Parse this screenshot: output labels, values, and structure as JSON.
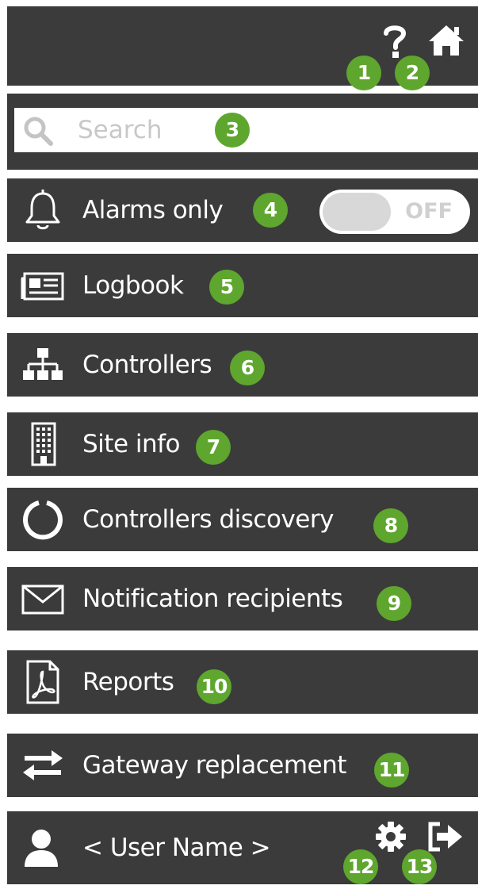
{
  "top_bar": {
    "help_icon": "question-mark-icon",
    "home_icon": "home-icon"
  },
  "search": {
    "placeholder": "Search"
  },
  "alarms": {
    "label": "Alarms only",
    "toggle_state": "OFF"
  },
  "menu": [
    {
      "label": "Logbook",
      "icon": "newspaper-icon"
    },
    {
      "label": "Controllers",
      "icon": "network-hierarchy-icon"
    },
    {
      "label": "Site info",
      "icon": "building-icon"
    },
    {
      "label": "Controllers discovery",
      "icon": "loading-ring-icon"
    },
    {
      "label": "Notification recipients",
      "icon": "envelope-icon"
    },
    {
      "label": "Reports",
      "icon": "pdf-document-icon"
    },
    {
      "label": "Gateway replacement",
      "icon": "swap-arrows-icon"
    }
  ],
  "user": {
    "name": "< User Name >",
    "settings_icon": "gear-icon",
    "logout_icon": "logout-icon"
  },
  "badges": [
    "1",
    "2",
    "3",
    "4",
    "5",
    "6",
    "7",
    "8",
    "9",
    "10",
    "11",
    "12",
    "13"
  ],
  "colors": {
    "panel": "#3b3b3b",
    "badge": "#5ea62e",
    "text": "#ffffff"
  }
}
